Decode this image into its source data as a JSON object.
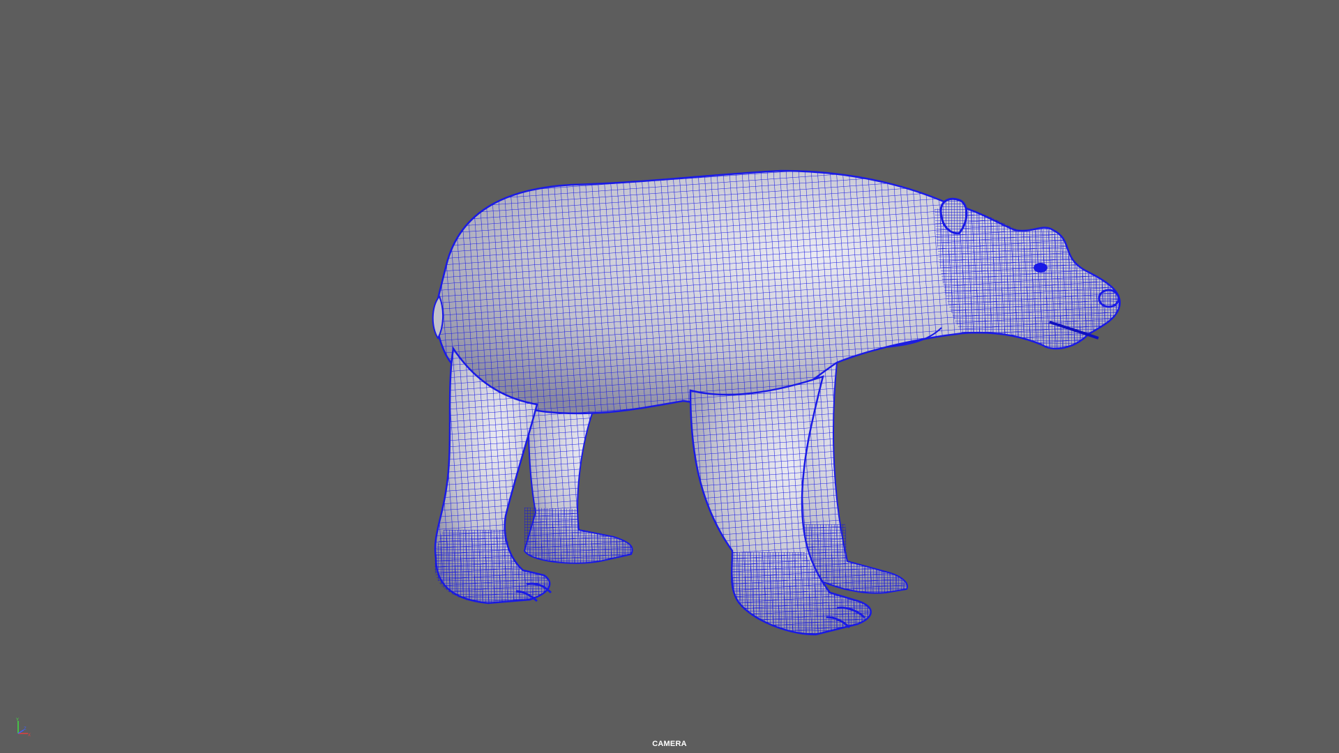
{
  "viewport": {
    "camera_label": "CAMERA",
    "background_color": "#5d5d5d"
  },
  "model": {
    "subject": "bear",
    "display_mode": "wireframe-on-shaded",
    "wire_color": "#1a1ae6",
    "shade_color": "#d4d4dc"
  },
  "axis_gizmo": {
    "icon": "axis-gizmo-icon",
    "axes": [
      "Y",
      "X",
      "Z"
    ],
    "colors": {
      "x": "#e04040",
      "y": "#40e040",
      "z": "#4060ff"
    }
  }
}
